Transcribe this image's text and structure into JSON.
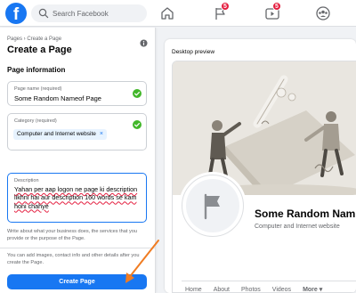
{
  "topbar": {
    "logo_letter": "f",
    "search_placeholder": "Search Facebook",
    "flag_badge": "5",
    "video_badge": "5"
  },
  "form": {
    "breadcrumb": "Pages › Create a Page",
    "title": "Create a Page",
    "section_title": "Page information",
    "page_name": {
      "label": "Page name (required)",
      "value": "Some Random Nameof Page"
    },
    "category": {
      "label": "Category (required)",
      "chip": "Computer and Internet website",
      "chip_remove": "×"
    },
    "description": {
      "label": "Description",
      "value": "Yahan per aap logon ne page ki description likhni hai aur description 160 words se kam honi chahye"
    },
    "description_helper": "Write about what your business does, the services that you provide or the purpose of the Page.",
    "footer_note": "You can add images, contact info and other details after you create the Page.",
    "create_button": "Create Page"
  },
  "preview": {
    "title": "Desktop preview",
    "page_name": "Some Random Nam",
    "category": "Computer and Internet website",
    "tabs": [
      "Home",
      "About",
      "Photos",
      "Videos"
    ],
    "more_tab": "More",
    "more_caret": "▾"
  },
  "colors": {
    "brand": "#1877f2",
    "badge": "#e41e3f",
    "success": "#42b72a",
    "annotation_arrow": "#f07c22"
  }
}
